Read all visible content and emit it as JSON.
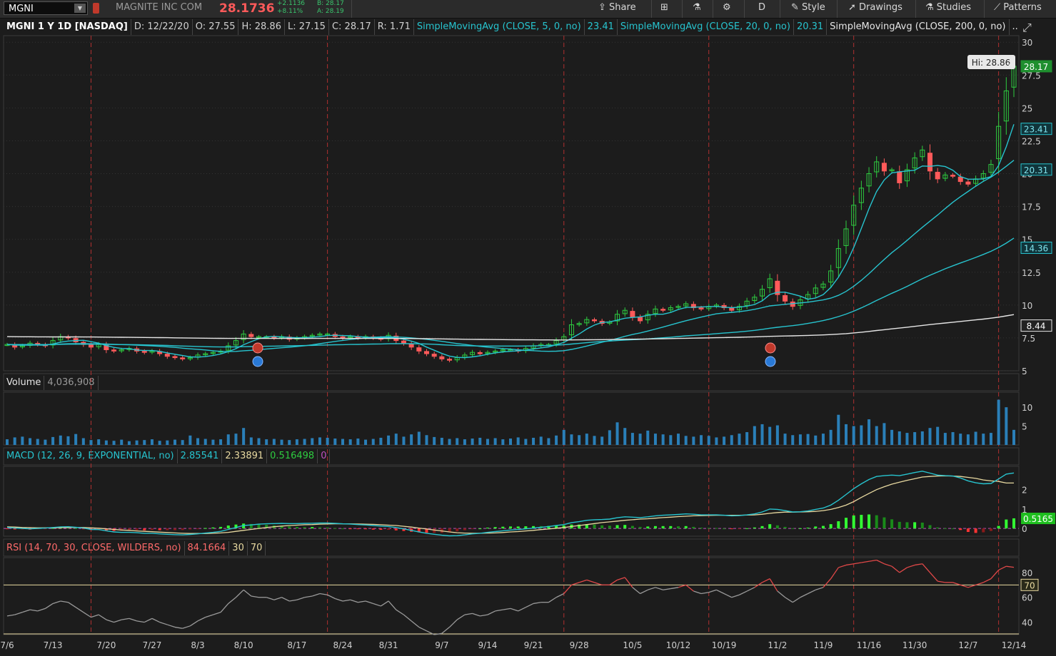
{
  "toolbar": {
    "symbol": "MGNI",
    "company": "MAGNITE INC COM",
    "price": "28.1736",
    "change_abs": "+2.1136",
    "change_pct": "+8.11%",
    "bid": "B: 28.17",
    "ask": "A: 28.19",
    "share_label": "Share",
    "aggregation_label": "D",
    "style_label": "Style",
    "drawings_label": "Drawings",
    "studies_label": "Studies",
    "patterns_label": "Patterns"
  },
  "info": {
    "title": "MGNI 1 Y 1D [NASDAQ]",
    "date": "D: 12/22/20",
    "open": "O: 27.55",
    "high": "H: 28.86",
    "low": "L: 27.15",
    "close": "C: 28.17",
    "range": "R: 1.71",
    "sma5_label": "SimpleMovingAvg (CLOSE, 5, 0, no)",
    "sma5_value": "23.41",
    "sma20_label": "SimpleMovingAvg (CLOSE, 20, 0, no)",
    "sma20_value": "20.31",
    "sma200_label": "SimpleMovingAvg (CLOSE, 200, 0, no)",
    "sma200_more": ".."
  },
  "price_panel": {
    "hi_label": "Hi: 28.86",
    "last_badge": "28.17",
    "sma5_badge": "23.41",
    "sma20_badge": "20.31",
    "sma50_badge": "14.36",
    "sma200_badge": "8.44",
    "colors": {
      "up": "#2ecc40",
      "down": "#ff5a5a",
      "sma_fast": "#27c4cf",
      "sma_200": "#e6e6e6",
      "grid": "#333333",
      "period_line": "#b03030"
    }
  },
  "volume_panel": {
    "label": "Volume",
    "value": "4,036,908",
    "axis_ticks": [
      "10",
      "5"
    ]
  },
  "macd_panel": {
    "label": "MACD (12, 26, 9, EXPONENTIAL, no)",
    "value": "2.85541",
    "avg": "2.33891",
    "diff": "0.516498",
    "zero": "0",
    "badge": "0.5165",
    "axis_ticks": [
      "2",
      "1",
      "0"
    ]
  },
  "rsi_panel": {
    "label": "RSI (14, 70, 30, CLOSE, WILDERS, no)",
    "value": "84.1664",
    "oversold": "30",
    "overbought": "70",
    "badge": "70",
    "axis_ticks": [
      "80",
      "60",
      "40"
    ]
  },
  "chart_data": {
    "type": "candlestick",
    "x_ticks": [
      "7/6",
      "7/13",
      "7/20",
      "7/27",
      "8/3",
      "8/10",
      "8/17",
      "8/24",
      "8/31",
      "9/7",
      "9/14",
      "9/21",
      "9/28",
      "10/5",
      "10/12",
      "10/19",
      "11/2",
      "11/9",
      "11/16",
      "11/30",
      "12/7",
      "12/14"
    ],
    "y_ticks": [
      5,
      7.5,
      10,
      12.5,
      15,
      17.5,
      20,
      22.5,
      25,
      27.5,
      30
    ],
    "ylim": [
      5,
      30.5
    ],
    "close": [
      7.0,
      6.8,
      6.9,
      7.1,
      7.0,
      6.9,
      7.3,
      7.6,
      7.5,
      7.2,
      7.0,
      6.8,
      7.0,
      6.6,
      6.5,
      6.6,
      6.7,
      6.5,
      6.4,
      6.5,
      6.3,
      6.1,
      6.0,
      5.9,
      6.0,
      6.2,
      6.3,
      6.4,
      6.5,
      6.9,
      7.3,
      7.8,
      7.6,
      7.6,
      7.6,
      7.5,
      7.6,
      7.4,
      7.5,
      7.6,
      7.7,
      7.8,
      7.8,
      7.6,
      7.5,
      7.6,
      7.5,
      7.6,
      7.5,
      7.4,
      7.7,
      7.3,
      7.1,
      6.8,
      6.5,
      6.3,
      6.1,
      5.9,
      5.8,
      6.0,
      6.2,
      6.4,
      6.3,
      6.4,
      6.5,
      6.6,
      6.6,
      6.5,
      6.7,
      6.9,
      7.0,
      7.0,
      7.3,
      7.6,
      8.5,
      8.6,
      8.9,
      8.8,
      8.6,
      8.7,
      9.3,
      9.6,
      9.1,
      8.8,
      9.3,
      9.7,
      9.6,
      9.8,
      9.9,
      10.1,
      9.8,
      9.7,
      9.9,
      10.0,
      9.8,
      9.6,
      9.9,
      10.3,
      10.6,
      11.2,
      12.0,
      10.8,
      10.3,
      9.9,
      10.4,
      10.8,
      11.3,
      11.6,
      12.6,
      14.3,
      15.8,
      17.6,
      18.9,
      20.0,
      20.9,
      20.2,
      20.3,
      19.3,
      20.3,
      21.2,
      21.8,
      20.2,
      19.6,
      19.9,
      19.8,
      19.4,
      19.2,
      19.6,
      20.0,
      20.7,
      23.6,
      26.3,
      28.17
    ],
    "volume_ylim": [
      0,
      14
    ],
    "volume": [
      1.5,
      2.0,
      2.2,
      1.8,
      1.6,
      1.4,
      2.1,
      2.5,
      2.3,
      2.9,
      1.8,
      1.3,
      1.5,
      1.2,
      1.1,
      1.4,
      1.0,
      1.2,
      1.3,
      1.5,
      1.1,
      1.2,
      1.4,
      1.3,
      2.5,
      1.8,
      1.6,
      1.4,
      1.5,
      2.8,
      3.0,
      4.5,
      2.0,
      1.8,
      1.5,
      1.6,
      1.4,
      1.3,
      1.5,
      1.6,
      1.8,
      2.0,
      1.9,
      1.7,
      1.6,
      1.5,
      1.7,
      1.4,
      1.6,
      1.9,
      2.5,
      3.0,
      2.2,
      2.8,
      3.5,
      2.6,
      2.1,
      1.9,
      1.6,
      1.8,
      1.5,
      1.7,
      1.9,
      1.6,
      1.8,
      1.5,
      1.7,
      2.0,
      1.6,
      1.9,
      2.2,
      1.8,
      2.5,
      4.0,
      2.8,
      2.6,
      3.0,
      2.4,
      2.2,
      3.9,
      6.0,
      4.5,
      3.2,
      3.0,
      3.8,
      3.0,
      2.8,
      2.6,
      3.0,
      2.4,
      2.2,
      2.6,
      2.4,
      2.0,
      2.2,
      2.6,
      3.0,
      3.4,
      5.0,
      5.5,
      4.8,
      5.2,
      3.0,
      2.6,
      2.8,
      2.9,
      2.5,
      3.0,
      4.0,
      8.0,
      5.5,
      5.0,
      5.2,
      6.8,
      5.0,
      5.8,
      4.0,
      3.6,
      3.2,
      3.4,
      3.6,
      4.5,
      4.8,
      3.2,
      3.4,
      3.0,
      2.8,
      3.5,
      3.0,
      3.2,
      12.0,
      10.0,
      4.0
    ],
    "macd_ylim": [
      -0.4,
      3.2
    ],
    "macd": [
      0.05,
      0.02,
      0.0,
      -0.02,
      0.0,
      0.02,
      0.05,
      0.08,
      0.09,
      0.06,
      0.02,
      -0.05,
      -0.06,
      -0.12,
      -0.18,
      -0.2,
      -0.2,
      -0.22,
      -0.25,
      -0.25,
      -0.28,
      -0.3,
      -0.32,
      -0.33,
      -0.31,
      -0.28,
      -0.24,
      -0.2,
      -0.15,
      -0.05,
      0.05,
      0.15,
      0.18,
      0.22,
      0.24,
      0.25,
      0.26,
      0.25,
      0.25,
      0.26,
      0.27,
      0.28,
      0.28,
      0.26,
      0.24,
      0.23,
      0.2,
      0.18,
      0.15,
      0.12,
      0.1,
      0.05,
      -0.02,
      -0.1,
      -0.18,
      -0.25,
      -0.3,
      -0.35,
      -0.38,
      -0.37,
      -0.33,
      -0.28,
      -0.25,
      -0.2,
      -0.16,
      -0.12,
      -0.08,
      -0.06,
      -0.02,
      0.02,
      0.06,
      0.1,
      0.15,
      0.2,
      0.3,
      0.35,
      0.42,
      0.45,
      0.46,
      0.48,
      0.55,
      0.6,
      0.58,
      0.56,
      0.6,
      0.65,
      0.68,
      0.7,
      0.72,
      0.75,
      0.73,
      0.7,
      0.7,
      0.7,
      0.68,
      0.65,
      0.66,
      0.7,
      0.75,
      0.85,
      1.0,
      0.98,
      0.92,
      0.85,
      0.86,
      0.9,
      0.98,
      1.05,
      1.2,
      1.45,
      1.75,
      2.05,
      2.3,
      2.52,
      2.68,
      2.72,
      2.75,
      2.72,
      2.8,
      2.88,
      2.95,
      2.85,
      2.75,
      2.72,
      2.7,
      2.6,
      2.45,
      2.35,
      2.3,
      2.32,
      2.55,
      2.8,
      2.86
    ],
    "macd_signal": [
      0.08,
      0.07,
      0.05,
      0.04,
      0.03,
      0.03,
      0.03,
      0.04,
      0.05,
      0.05,
      0.05,
      0.03,
      0.01,
      -0.02,
      -0.05,
      -0.08,
      -0.1,
      -0.13,
      -0.15,
      -0.17,
      -0.19,
      -0.21,
      -0.23,
      -0.25,
      -0.26,
      -0.26,
      -0.26,
      -0.25,
      -0.23,
      -0.2,
      -0.15,
      -0.1,
      -0.05,
      0.0,
      0.05,
      0.09,
      0.12,
      0.15,
      0.17,
      0.19,
      0.2,
      0.22,
      0.23,
      0.24,
      0.24,
      0.24,
      0.23,
      0.22,
      0.21,
      0.19,
      0.17,
      0.15,
      0.11,
      0.07,
      0.02,
      -0.03,
      -0.08,
      -0.13,
      -0.18,
      -0.22,
      -0.24,
      -0.25,
      -0.25,
      -0.24,
      -0.23,
      -0.21,
      -0.18,
      -0.16,
      -0.13,
      -0.1,
      -0.06,
      -0.03,
      0.01,
      0.05,
      0.1,
      0.15,
      0.2,
      0.25,
      0.3,
      0.34,
      0.38,
      0.42,
      0.45,
      0.48,
      0.5,
      0.53,
      0.56,
      0.58,
      0.61,
      0.63,
      0.65,
      0.66,
      0.67,
      0.68,
      0.68,
      0.68,
      0.68,
      0.69,
      0.7,
      0.73,
      0.78,
      0.82,
      0.84,
      0.84,
      0.85,
      0.86,
      0.88,
      0.92,
      0.98,
      1.08,
      1.2,
      1.38,
      1.6,
      1.8,
      2.0,
      2.15,
      2.28,
      2.38,
      2.48,
      2.56,
      2.65,
      2.68,
      2.7,
      2.71,
      2.7,
      2.68,
      2.63,
      2.58,
      2.5,
      2.45,
      2.42,
      2.34,
      2.34
    ],
    "rsi_ylim": [
      30,
      92
    ],
    "rsi": [
      45,
      46,
      48,
      50,
      49,
      51,
      55,
      57,
      56,
      52,
      48,
      44,
      46,
      42,
      40,
      42,
      43,
      41,
      40,
      43,
      40,
      38,
      36,
      35,
      37,
      41,
      44,
      46,
      48,
      55,
      60,
      66,
      61,
      60,
      60,
      58,
      60,
      57,
      58,
      60,
      61,
      63,
      62,
      59,
      57,
      58,
      56,
      57,
      55,
      53,
      57,
      50,
      46,
      41,
      36,
      33,
      30,
      31,
      36,
      42,
      46,
      47,
      45,
      46,
      49,
      50,
      51,
      49,
      52,
      55,
      56,
      56,
      60,
      63,
      70,
      72,
      74,
      72,
      70,
      70,
      74,
      76,
      68,
      63,
      66,
      68,
      66,
      67,
      68,
      70,
      65,
      63,
      64,
      66,
      63,
      60,
      62,
      65,
      68,
      72,
      75,
      65,
      60,
      56,
      60,
      63,
      66,
      68,
      75,
      84,
      86,
      87,
      88,
      89,
      90,
      87,
      85,
      80,
      84,
      86,
      87,
      80,
      73,
      72,
      72,
      70,
      68,
      70,
      72,
      75,
      82,
      85,
      84.2
    ],
    "period_markers": [
      "7/20",
      "8/24",
      "9/28",
      "10/19",
      "11/16",
      "12/14"
    ]
  }
}
